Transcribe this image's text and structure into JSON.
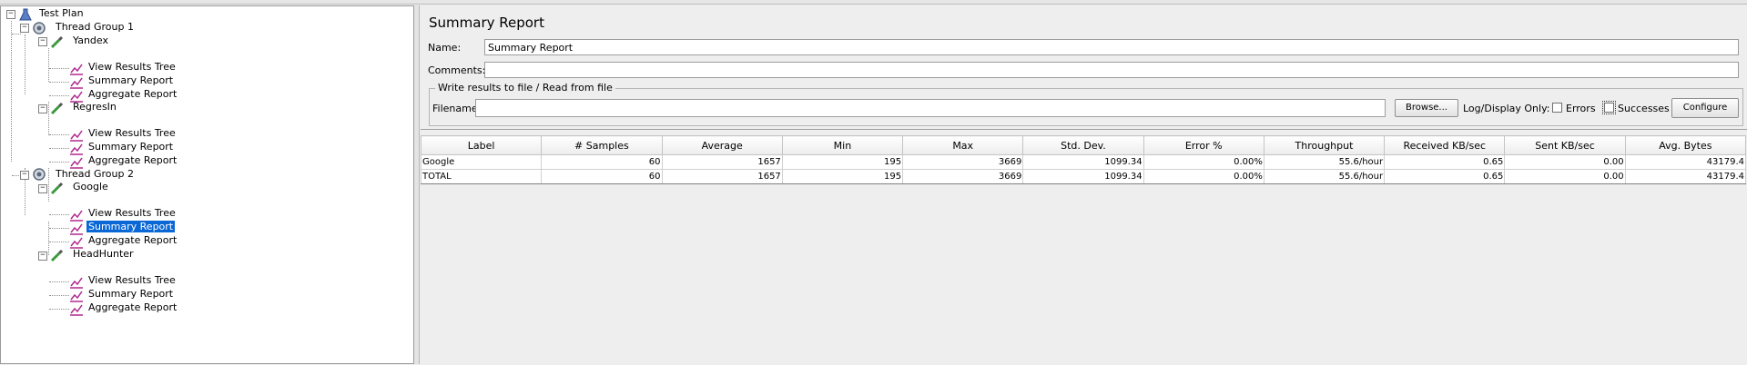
{
  "tree": {
    "test_plan": "Test Plan",
    "thread_group_1": "Thread Group 1",
    "yandex": "Yandex",
    "yandex_children": [
      "View Results Tree",
      "Summary Report",
      "Aggregate Report"
    ],
    "regresin": "RegresIn",
    "regresin_children": [
      "View Results Tree",
      "Summary Report",
      "Aggregate Report"
    ],
    "thread_group_2": "Thread Group 2",
    "google": "Google",
    "google_children": [
      "View Results Tree",
      "Summary Report",
      "Aggregate Report"
    ],
    "headhunter": "HeadHunter",
    "headhunter_children": [
      "View Results Tree",
      "Summary Report",
      "Aggregate Report"
    ],
    "selected": "Summary Report (Google)"
  },
  "panel": {
    "title": "Summary Report",
    "name_label": "Name:",
    "name_value": "Summary Report",
    "comments_label": "Comments:",
    "comments_value": "",
    "file_section": "Write results to file / Read from file",
    "filename_label": "Filename",
    "filename_value": "",
    "browse_button": "Browse...",
    "log_display_label": "Log/Display Only:",
    "errors_label": "Errors",
    "successes_label": "Successes",
    "configure_button": "Configure"
  },
  "table": {
    "columns": [
      "Label",
      "# Samples",
      "Average",
      "Min",
      "Max",
      "Std. Dev.",
      "Error %",
      "Throughput",
      "Received KB/sec",
      "Sent KB/sec",
      "Avg. Bytes"
    ],
    "rows": [
      [
        "Google",
        "60",
        "1657",
        "195",
        "3669",
        "1099.34",
        "0.00%",
        "55.6/hour",
        "0.65",
        "0.00",
        "43179.4"
      ],
      [
        "TOTAL",
        "60",
        "1657",
        "195",
        "3669",
        "1099.34",
        "0.00%",
        "55.6/hour",
        "0.65",
        "0.00",
        "43179.4"
      ]
    ]
  },
  "colors": {
    "selection": "#0a67d6",
    "background": "#eeeeee"
  },
  "icons": {
    "test_plan": "flask-icon",
    "thread_group": "gear-icon",
    "sampler": "pipette-icon",
    "listener": "graph-icon"
  }
}
